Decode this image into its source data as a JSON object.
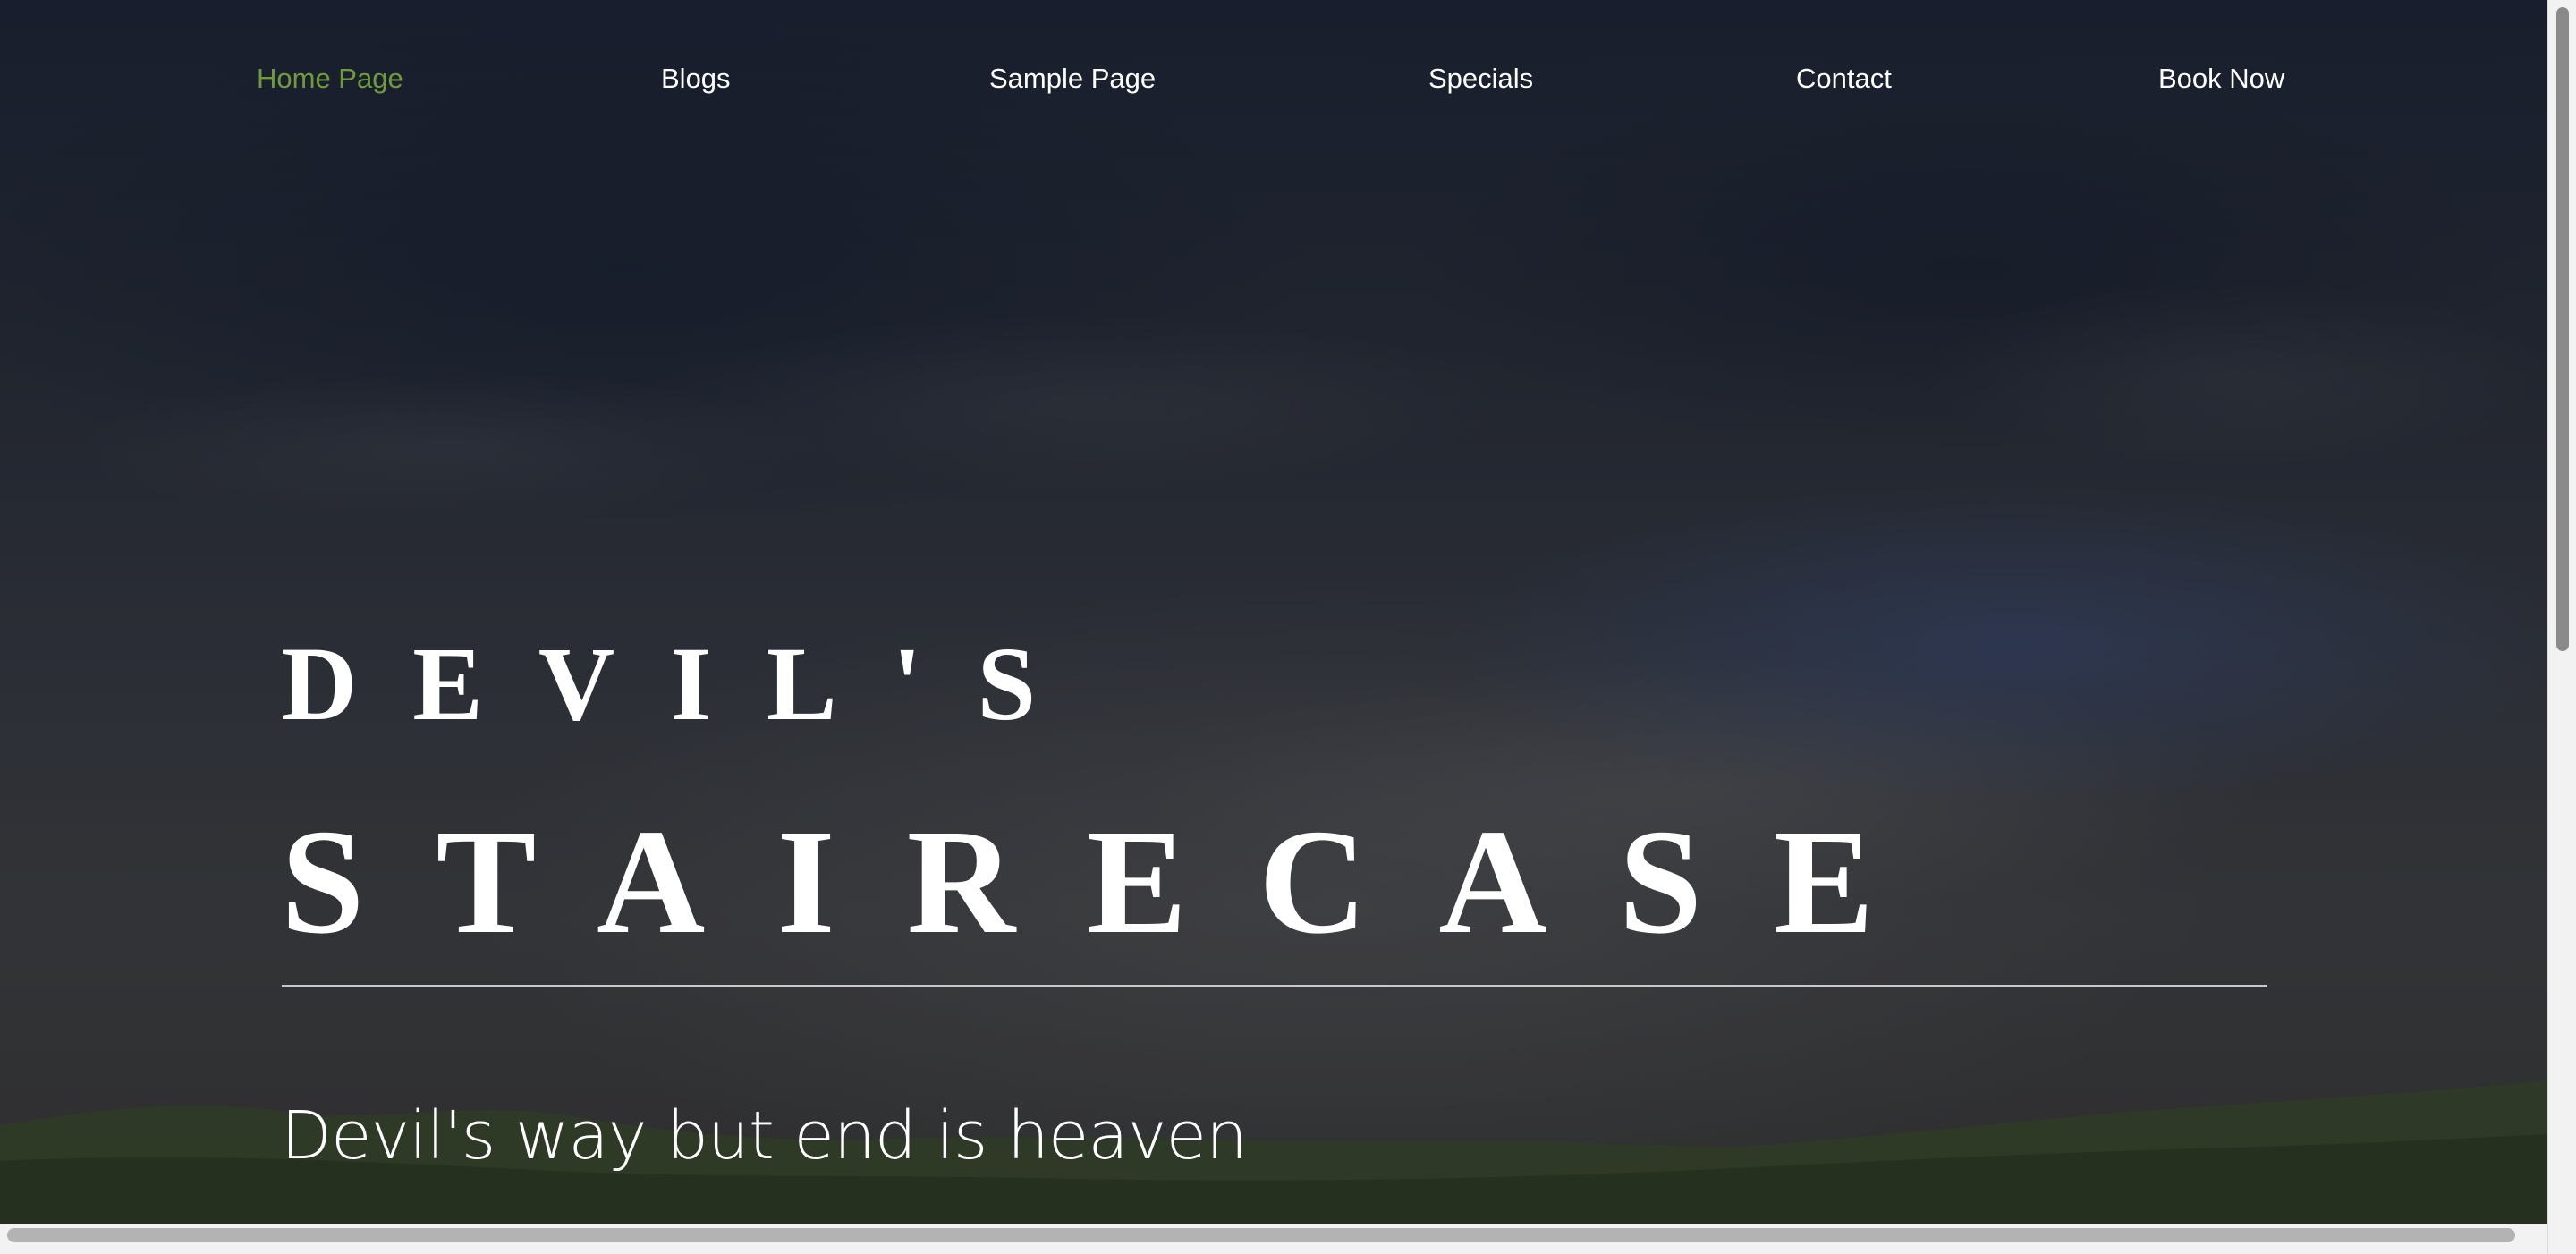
{
  "nav": {
    "items": [
      {
        "label": "Home Page",
        "active": true
      },
      {
        "label": "Blogs",
        "active": false
      },
      {
        "label": "Sample Page",
        "active": false
      },
      {
        "label": "Specials",
        "active": false
      },
      {
        "label": "Contact",
        "active": false
      },
      {
        "label": "Book Now",
        "active": false
      }
    ]
  },
  "hero": {
    "title_line1": "DEVIL'S",
    "title_line2": "STAIRECASE",
    "tagline": "Devil's way but end is heaven"
  },
  "colors": {
    "active_nav": "#6f9b3c",
    "text": "#ffffff",
    "rule": "#c9c9c9"
  }
}
